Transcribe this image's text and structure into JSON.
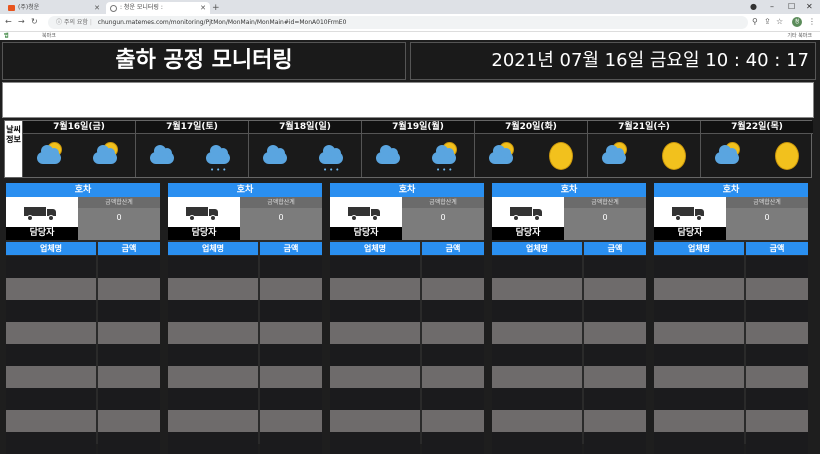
{
  "browser": {
    "tabs": [
      {
        "label": "(주)청운",
        "active": false
      },
      {
        "label": ": 청운 모니터링 :",
        "active": true
      }
    ],
    "address": {
      "security": "주의 요함",
      "url": "chungun.matemes.com/monitoring/PjtMon/MonMain/MonMain#id=MonA010FrmE0"
    },
    "bookmarks": {
      "apps": "앱",
      "first": "북마크",
      "other": "기타 북마크"
    },
    "avatar_initials": "청"
  },
  "page": {
    "title": "출하 공정 모니터링",
    "datetime": "2021년 07월 16일 금요일 10 : 40 : 17",
    "weather": {
      "label": "날씨정보",
      "days": [
        {
          "date": "7월16일(금)",
          "am": "partly-cloudy-icon",
          "pm": "partly-cloudy-icon"
        },
        {
          "date": "7월17일(토)",
          "am": "cloudy-icon",
          "pm": "rain-icon"
        },
        {
          "date": "7월18일(일)",
          "am": "cloudy-icon",
          "pm": "rain-icon"
        },
        {
          "date": "7월19일(월)",
          "am": "cloudy-icon",
          "pm": "partly-cloudy-rain-icon"
        },
        {
          "date": "7월20일(화)",
          "am": "partly-cloudy-icon",
          "pm": "sunny-icon"
        },
        {
          "date": "7월21일(수)",
          "am": "partly-cloudy-icon",
          "pm": "sunny-icon"
        },
        {
          "date": "7월22일(목)",
          "am": "partly-cloudy-icon",
          "pm": "sunny-icon"
        }
      ]
    },
    "panels": [
      {
        "header": "호차",
        "sum_label": "금액합산계",
        "sum_value": "0",
        "manager_label": "담당자",
        "col_company": "업체명",
        "col_amount": "금액"
      },
      {
        "header": "호차",
        "sum_label": "금액합산계",
        "sum_value": "0",
        "manager_label": "담당자",
        "col_company": "업체명",
        "col_amount": "금액"
      },
      {
        "header": "호차",
        "sum_label": "금액합산계",
        "sum_value": "0",
        "manager_label": "담당자",
        "col_company": "업체명",
        "col_amount": "금액"
      },
      {
        "header": "호차",
        "sum_label": "금액합산계",
        "sum_value": "0",
        "manager_label": "담당자",
        "col_company": "업체명",
        "col_amount": "금액"
      },
      {
        "header": "호차",
        "sum_label": "금액합산계",
        "sum_value": "0",
        "manager_label": "담당자",
        "col_company": "업체명",
        "col_amount": "금액"
      }
    ],
    "colors": {
      "accent": "#2a8ff0",
      "row_dark": "#1b1b1d",
      "row_light": "#6e6b6b"
    }
  }
}
